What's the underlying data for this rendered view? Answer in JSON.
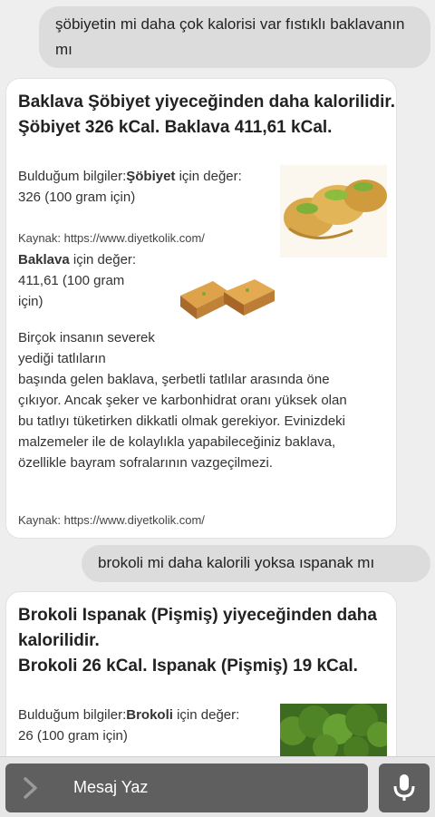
{
  "messages": [
    {
      "role": "user",
      "text": "şöbiyetin mi daha çok kalorisi var fıstıklı baklavanın mı"
    },
    {
      "role": "bot",
      "title_lines": [
        "Baklava Şöbiyet yiyeceğinden daha kalorilidir.",
        "Şöbiyet 326 kCal. Baklava 411,61 kCal."
      ],
      "info1": {
        "prefix": "Bulduğum bilgiler:",
        "food": "Şöbiyet",
        "suffix": " için değer:",
        "value": "326 (100 gram için)"
      },
      "source1": "Kaynak: https://www.diyetkolik.com/",
      "info2": {
        "food": "Baklava",
        "suffix": " için değer:",
        "value_lines": [
          "411,61 (100 gram",
          "için)"
        ]
      },
      "desc_lines": [
        "Birçok insanın severek",
        "yediği tatlıların",
        "başında gelen baklava, şerbetli tatlılar arasında öne",
        "çıkıyor. Ancak şeker ve karbonhidrat oranı yüksek olan",
        "bu tatlıyı tüketirken dikkatli olmak gerekiyor. Evinizdeki",
        "malzemeler ile de kolaylıkla yapabileceğiniz baklava,",
        "özellikle bayram sofralarının vazgeçilmezi."
      ],
      "source2": "Kaynak: https://www.diyetkolik.com/"
    },
    {
      "role": "user",
      "text": "brokoli mi daha kalorili yoksa ıspanak mı"
    },
    {
      "role": "bot",
      "title_lines": [
        "Brokoli Ispanak (Pişmiş) yiyeceğinden daha",
        "kalorilidir.",
        "Brokoli 26 kCal. Ispanak (Pişmiş) 19 kCal."
      ],
      "info1": {
        "prefix": "Bulduğum bilgiler:",
        "food": "Brokoli",
        "suffix": " için değer:",
        "value": "26 (100 gram için)"
      }
    }
  ],
  "input": {
    "placeholder": "Mesaj Yaz"
  },
  "icons": {
    "input_left": "chevron-right-icon",
    "mic": "microphone-icon"
  },
  "colors": {
    "background": "#eeeeee",
    "user_bubble": "#dcdcdc",
    "input_bar": "#5f5f5f"
  }
}
